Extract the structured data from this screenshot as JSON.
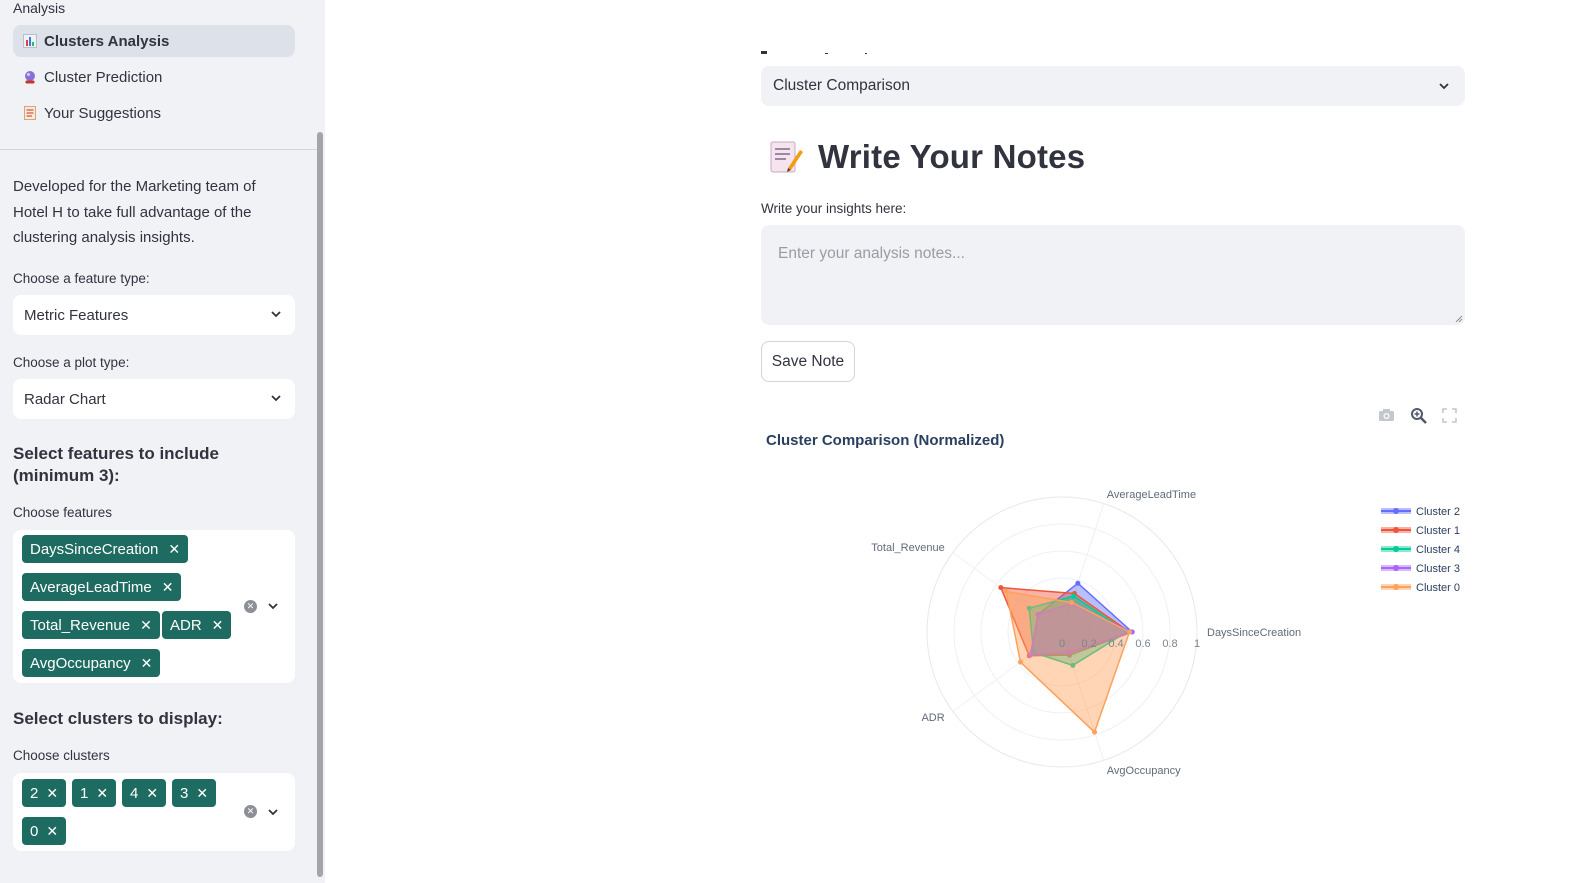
{
  "sidebar": {
    "nav_heading": "Analysis",
    "nav": [
      {
        "label": "Clusters Analysis",
        "icon": "bar-chart-icon",
        "active": true
      },
      {
        "label": "Cluster Prediction",
        "icon": "crystal-ball-icon",
        "active": false
      },
      {
        "label": "Your Suggestions",
        "icon": "memo-icon",
        "active": false
      }
    ],
    "description": "Developed for the Marketing team of Hotel H to take full advantage of the clustering analysis insights.",
    "feature_type_label": "Choose a feature type:",
    "feature_type_value": "Metric Features",
    "plot_type_label": "Choose a plot type:",
    "plot_type_value": "Radar Chart",
    "features_heading": "Select features to include (minimum 3):",
    "features_label": "Choose features",
    "features": [
      "DaysSinceCreation",
      "AverageLeadTime",
      "Total_Revenue",
      "ADR",
      "AvgOccupancy"
    ],
    "clusters_heading": "Select clusters to display:",
    "clusters_label": "Choose clusters",
    "clusters": [
      "2",
      "1",
      "4",
      "3",
      "0"
    ],
    "chip_color": "#1e6b61"
  },
  "main": {
    "view_select_value": "Cluster Comparison",
    "notes_title": "Write Your Notes",
    "notes_label": "Write your insights here:",
    "notes_placeholder": "Enter your analysis notes...",
    "notes_value": "",
    "save_button": "Save Note",
    "chart_toolbar": [
      "camera-icon",
      "zoom-icon",
      "fullscreen-icon"
    ]
  },
  "chart_data": {
    "type": "radar",
    "title": "Cluster Comparison (Normalized)",
    "axes": [
      "DaysSinceCreation",
      "AverageLeadTime",
      "Total_Revenue",
      "ADR",
      "AvgOccupancy"
    ],
    "radial_ticks": [
      "0",
      "0.2",
      "0.4",
      "0.6",
      "0.8",
      "1"
    ],
    "radial_range": [
      0,
      1
    ],
    "legend_position": "top-right",
    "series": [
      {
        "name": "Cluster 2",
        "color": "#636efa",
        "values": [
          0.52,
          0.38,
          0.22,
          0.28,
          0.18
        ]
      },
      {
        "name": "Cluster 1",
        "color": "#ef553b",
        "values": [
          0.5,
          0.3,
          0.56,
          0.3,
          0.18
        ]
      },
      {
        "name": "Cluster 4",
        "color": "#00cc96",
        "values": [
          0.48,
          0.28,
          0.3,
          0.26,
          0.26
        ]
      },
      {
        "name": "Cluster 3",
        "color": "#ab63fa",
        "values": [
          0.52,
          0.22,
          0.22,
          0.29,
          0.16
        ]
      },
      {
        "name": "Cluster 0",
        "color": "#ffa15a",
        "values": [
          0.5,
          0.23,
          0.51,
          0.38,
          0.78
        ]
      }
    ]
  }
}
